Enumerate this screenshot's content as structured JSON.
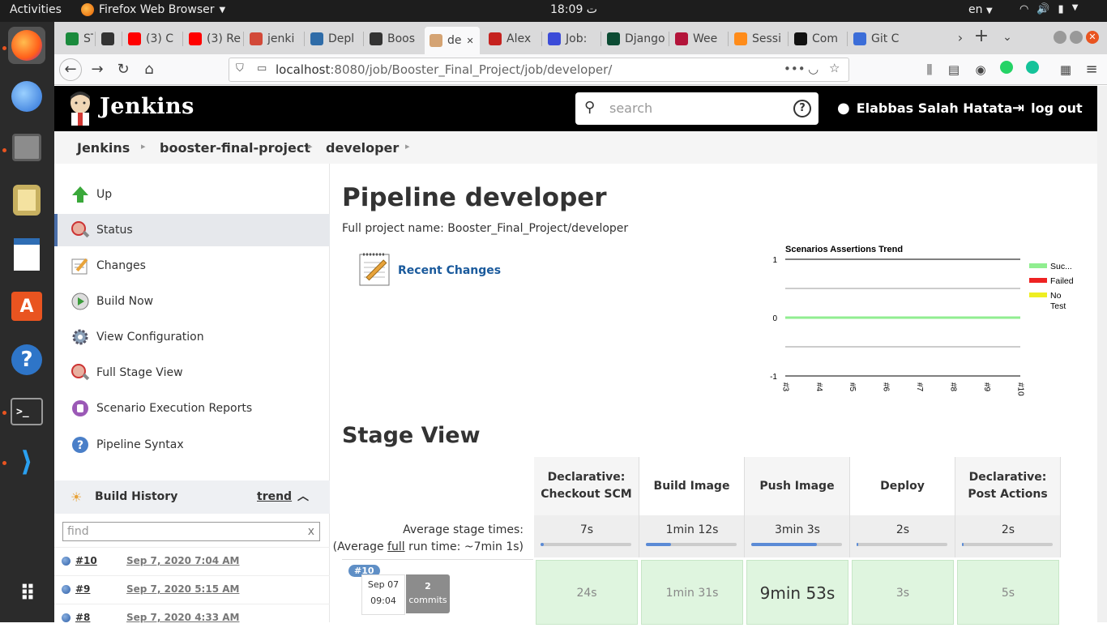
{
  "topbar": {
    "activities": "Activities",
    "app_name": "Firefox Web Browser",
    "clock": "18:09 ت",
    "lang": "en"
  },
  "browser": {
    "tabs": [
      {
        "label": "ST!",
        "color": "#1a8a3c"
      },
      {
        "label": "",
        "color": "#333333"
      },
      {
        "label": "(3) C",
        "color": "#ff0000"
      },
      {
        "label": "(3) Re",
        "color": "#ff0000"
      },
      {
        "label": "jenki",
        "color": "#d24939"
      },
      {
        "label": "Depl",
        "color": "#2f6ca8"
      },
      {
        "label": "Boos",
        "color": "#333333"
      },
      {
        "label": "de",
        "color": "#d4a373"
      },
      {
        "label": "Alex",
        "color": "#c5221f"
      },
      {
        "label": "Job:",
        "color": "#3b4bd8"
      },
      {
        "label": "Django:",
        "color": "#0c4b33"
      },
      {
        "label": "Wee",
        "color": "#b3143a"
      },
      {
        "label": "Sessi",
        "color": "#ff8c1a"
      },
      {
        "label": "Com",
        "color": "#111111"
      },
      {
        "label": "Git C",
        "color": "#3b6dd8"
      }
    ],
    "url_host": "localhost",
    "url_path": ":8080/job/Booster_Final_Project/job/developer/"
  },
  "jenkins": {
    "brand": "Jenkins",
    "search_placeholder": "search",
    "user": "Elabbas Salah Hatata",
    "logout": "log out"
  },
  "breadcrumb": [
    "Jenkins",
    "booster-final-project",
    "developer"
  ],
  "sidebar": {
    "items": [
      {
        "label": "Up",
        "icon": "up-arrow-icon"
      },
      {
        "label": "Status",
        "icon": "status-icon"
      },
      {
        "label": "Changes",
        "icon": "changes-icon"
      },
      {
        "label": "Build Now",
        "icon": "build-now-icon"
      },
      {
        "label": "View Configuration",
        "icon": "gear-icon"
      },
      {
        "label": "Full Stage View",
        "icon": "stage-view-icon"
      },
      {
        "label": "Scenario Execution Reports",
        "icon": "report-icon"
      },
      {
        "label": "Pipeline Syntax",
        "icon": "help-icon"
      }
    ],
    "build_history": {
      "title": "Build History",
      "trend": "trend",
      "find_placeholder": "find",
      "clear": "x",
      "builds": [
        {
          "num": "#10",
          "date": "Sep 7, 2020 7:04 AM"
        },
        {
          "num": "#9",
          "date": "Sep 7, 2020 5:15 AM"
        },
        {
          "num": "#8",
          "date": "Sep 7, 2020 4:33 AM"
        }
      ]
    }
  },
  "main": {
    "title": "Pipeline developer",
    "full_name": "Full project name: Booster_Final_Project/developer",
    "recent_changes": "Recent Changes",
    "stage_view_title": "Stage View",
    "avg_label": "Average stage times:",
    "avg_full_prefix": "(Average ",
    "avg_full_link": "full",
    "avg_full_suffix": " run time: ~7min 1s)",
    "stages": [
      {
        "name_l1": "Declarative:",
        "name_l2": "Checkout SCM",
        "avg": "7s",
        "avg_fraction": 0.04,
        "run": "24s"
      },
      {
        "name_l1": "Build Image",
        "name_l2": "",
        "avg": "1min 12s",
        "avg_fraction": 0.28,
        "run": "1min 31s"
      },
      {
        "name_l1": "Push Image",
        "name_l2": "",
        "avg": "3min 3s",
        "avg_fraction": 0.72,
        "run": "9min 53s"
      },
      {
        "name_l1": "Deploy",
        "name_l2": "",
        "avg": "2s",
        "avg_fraction": 0.02,
        "run": "3s"
      },
      {
        "name_l1": "Declarative:",
        "name_l2": "Post Actions",
        "avg": "2s",
        "avg_fraction": 0.02,
        "run": "5s"
      }
    ],
    "build": {
      "num": "#10",
      "date": "Sep 07",
      "time": "09:04",
      "commits_count": "2",
      "commits_label": "commits"
    }
  },
  "chart_data": {
    "type": "line",
    "title": "Scenarios Assertions Trend",
    "x": [
      "#3",
      "#4",
      "#5",
      "#6",
      "#7",
      "#8",
      "#9",
      "#10"
    ],
    "series": [
      {
        "name": "Suc...",
        "color": "#90ee90",
        "values": [
          0,
          0,
          0,
          0,
          0,
          0,
          0,
          0
        ]
      },
      {
        "name": "Failed",
        "color": "#ee2222",
        "values": [
          0,
          0,
          0,
          0,
          0,
          0,
          0,
          0
        ]
      },
      {
        "name": "No Test",
        "color": "#eeee22",
        "values": [
          0,
          0,
          0,
          0,
          0,
          0,
          0,
          0
        ]
      }
    ],
    "yticks": [
      "1",
      "0",
      "-1"
    ],
    "ylim": [
      -1,
      1
    ],
    "legend": "right",
    "grid": true
  }
}
